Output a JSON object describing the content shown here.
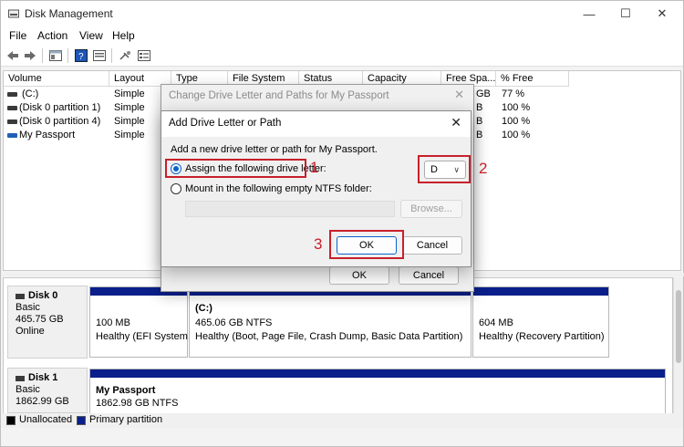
{
  "window": {
    "title": "Disk Management",
    "minimize": "—",
    "maximize": "☐",
    "close": "✕"
  },
  "menu": [
    "File",
    "Action",
    "View",
    "Help"
  ],
  "toolbar": {
    "icons": [
      "back-arrow-icon",
      "forward-arrow-icon",
      "console-tree-icon",
      "help-icon",
      "properties-icon",
      "connect-icon",
      "settings-icon"
    ]
  },
  "volume_table": {
    "columns": [
      "Volume",
      "Layout",
      "Type",
      "File System",
      "Status",
      "Capacity",
      "Free Spa...",
      "% Free"
    ],
    "rows": [
      {
        "volume": "(C:)",
        "layout": "Simple",
        "free": "GB",
        "pct": "77 %",
        "icon": "drive-icon"
      },
      {
        "volume": "(Disk 0 partition 1)",
        "layout": "Simple",
        "free": "B",
        "pct": "100 %",
        "icon": "drive-icon"
      },
      {
        "volume": "(Disk 0 partition 4)",
        "layout": "Simple",
        "free": "B",
        "pct": "100 %",
        "icon": "drive-icon"
      },
      {
        "volume": "My Passport",
        "layout": "Simple",
        "free": "B",
        "pct": "100 %",
        "icon": "usb-drive-icon"
      }
    ]
  },
  "disks": [
    {
      "name": "Disk 0",
      "type": "Basic",
      "size": "465.75 GB",
      "status": "Online",
      "partitions": [
        {
          "title": "",
          "line1": "100 MB",
          "line2": "Healthy (EFI System"
        },
        {
          "title": "(C:)",
          "line1": "465.06 GB NTFS",
          "line2": "Healthy (Boot, Page File, Crash Dump, Basic Data Partition)"
        },
        {
          "title": "",
          "line1": "604 MB",
          "line2": "Healthy (Recovery Partition)"
        }
      ]
    },
    {
      "name": "Disk 1",
      "type": "Basic",
      "size": "1862.99 GB",
      "status": "",
      "partitions": [
        {
          "title": "My Passport",
          "line1": "1862.98 GB NTFS",
          "line2": ""
        }
      ]
    }
  ],
  "legend": {
    "unallocated": "Unallocated",
    "primary": "Primary partition",
    "unallocated_color": "#000000",
    "primary_color": "#0a1f8a"
  },
  "dialog_back": {
    "title": "Change Drive Letter and Paths for My Passport",
    "ok": "OK",
    "cancel": "Cancel"
  },
  "dialog_front": {
    "title": "Add Drive Letter or Path",
    "description": "Add a new drive letter or path for My Passport.",
    "option_assign": "Assign the following drive letter:",
    "option_mount": "Mount in the following empty NTFS folder:",
    "drive_letter": "D",
    "browse": "Browse...",
    "ok": "OK",
    "cancel": "Cancel"
  },
  "annotations": {
    "step1": "1",
    "step2": "2",
    "step3": "3",
    "color": "#c8202a"
  }
}
